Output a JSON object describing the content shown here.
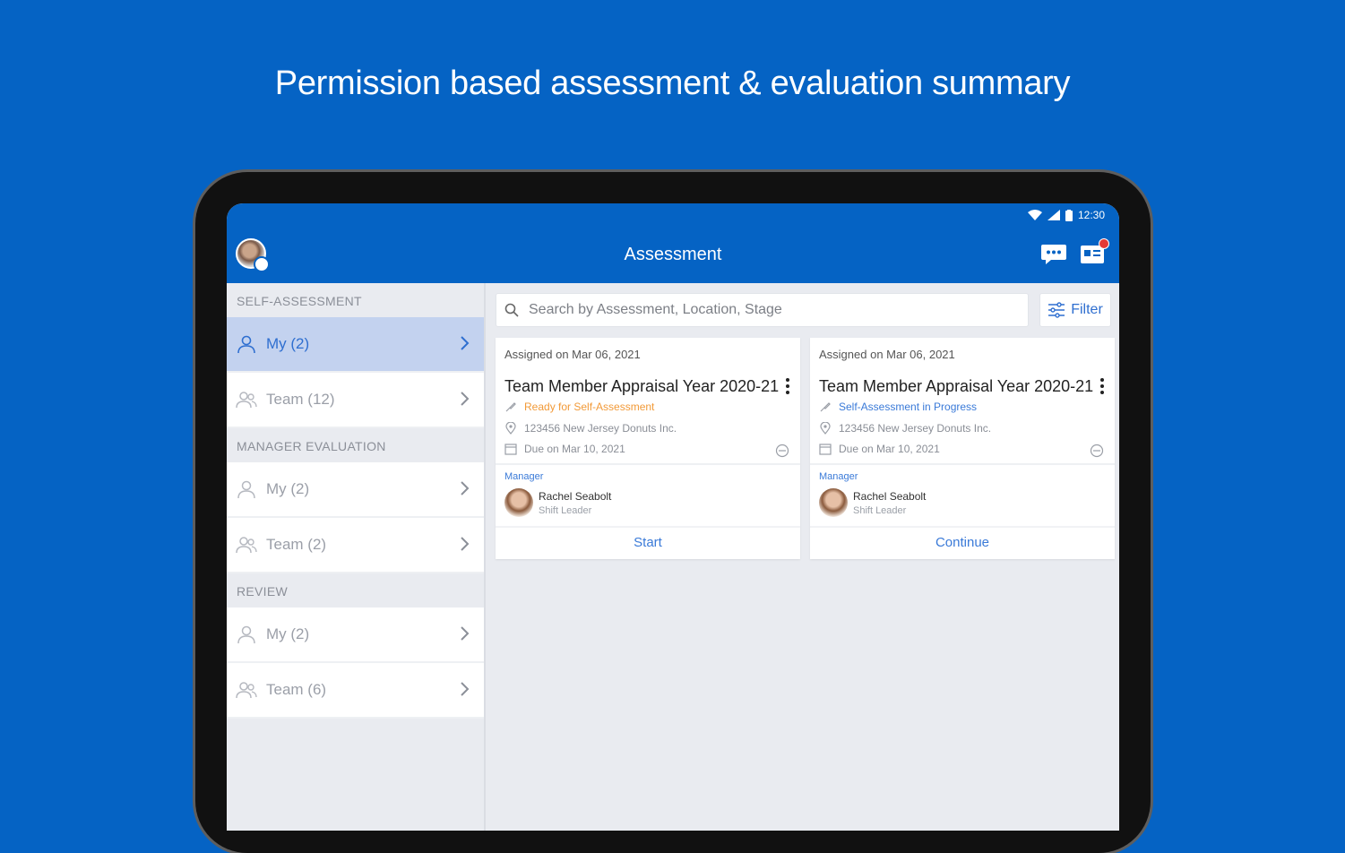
{
  "headline": "Permission based assessment & evaluation summary",
  "status": {
    "time": "12:30"
  },
  "appbar": {
    "title": "Assessment"
  },
  "sidebar": {
    "sections": [
      {
        "header": "SELF-ASSESSMENT",
        "items": [
          {
            "label": "My (2)",
            "active": true
          },
          {
            "label": "Team (12)"
          }
        ]
      },
      {
        "header": "MANAGER EVALUATION",
        "items": [
          {
            "label": "My (2)"
          },
          {
            "label": "Team (2)"
          }
        ]
      },
      {
        "header": "REVIEW",
        "items": [
          {
            "label": "My (2)"
          },
          {
            "label": "Team (6)"
          }
        ]
      }
    ]
  },
  "search": {
    "placeholder": "Search by Assessment, Location, Stage"
  },
  "filter": {
    "label": "Filter"
  },
  "cards": [
    {
      "assigned": "Assigned on Mar 06, 2021",
      "title": "Team Member Appraisal Year 2020-21",
      "status": "Ready for Self-Assessment",
      "status_color": "#f29a38",
      "location": "123456 New Jersey Donuts Inc.",
      "due": "Due on Mar 10, 2021",
      "manager_label": "Manager",
      "manager_name": "Rachel Seabolt",
      "manager_role": "Shift Leader",
      "action": "Start"
    },
    {
      "assigned": "Assigned on Mar 06, 2021",
      "title": "Team Member Appraisal Year 2020-21",
      "status": "Self-Assessment in Progress",
      "status_color": "#3a7ad8",
      "location": "123456 New Jersey Donuts Inc.",
      "due": "Due on Mar 10, 2021",
      "manager_label": "Manager",
      "manager_name": "Rachel Seabolt",
      "manager_role": "Shift Leader",
      "action": "Continue"
    }
  ],
  "colors": {
    "brand": "#0563c4",
    "accent": "#2f6fd0",
    "active_bg": "#c3d2ef"
  },
  "icons": [
    "wifi-icon",
    "signal-icon",
    "battery-icon",
    "chat-help-icon",
    "inbox-icon",
    "user-icon",
    "users-icon",
    "chevron-right-icon",
    "search-icon",
    "filter-icon",
    "kebab-icon",
    "status-icon",
    "location-icon",
    "calendar-icon"
  ]
}
